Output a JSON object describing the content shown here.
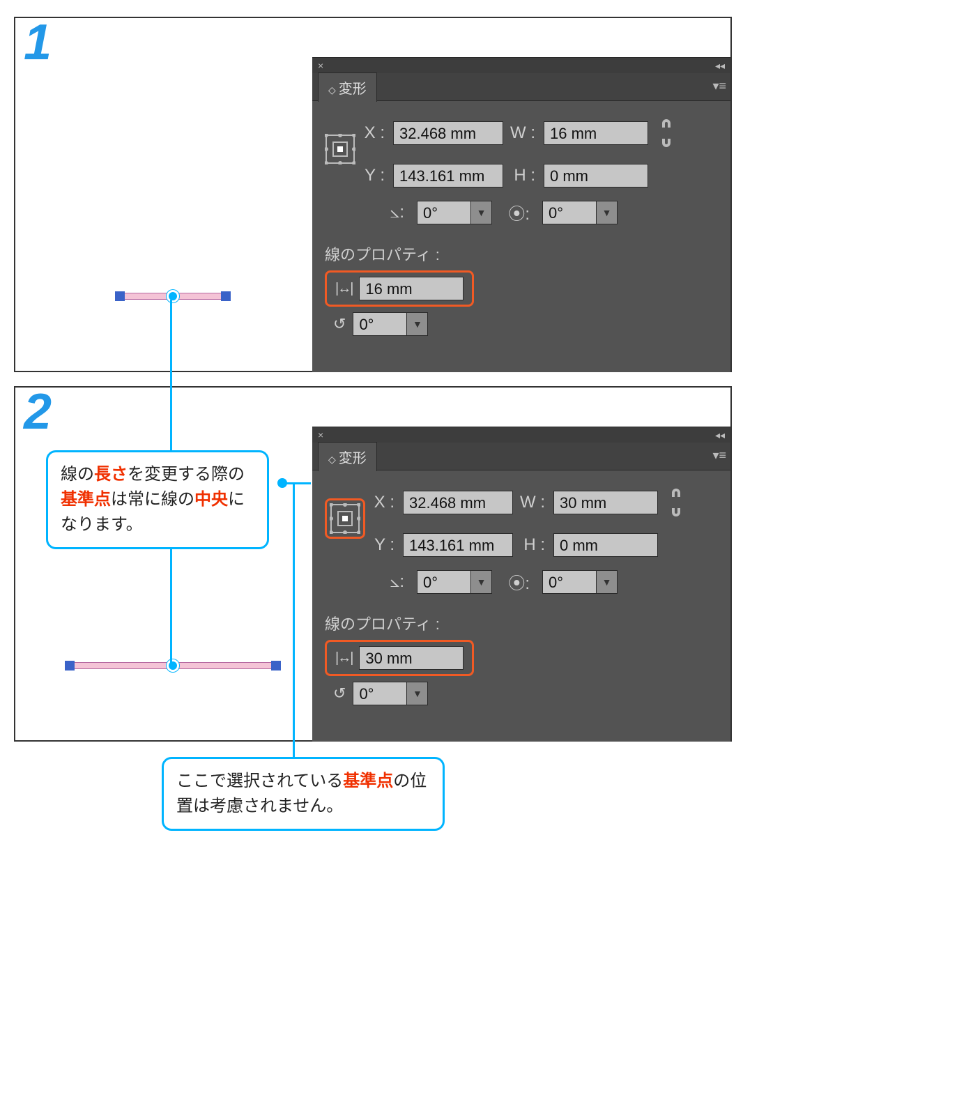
{
  "panel": {
    "title": "変形",
    "section_label": "線のプロパティ :",
    "labels": {
      "x": "X :",
      "y": "Y :",
      "w": "W :",
      "h": "H :"
    },
    "rotation": "0°",
    "shear": "0°"
  },
  "step1": {
    "num": "1",
    "x": "32.468 mm",
    "y": "143.161 mm",
    "w": "16 mm",
    "h": "0 mm",
    "length": "16 mm",
    "line_angle": "0°"
  },
  "step2": {
    "num": "2",
    "x": "32.468 mm",
    "y": "143.161 mm",
    "w": "30 mm",
    "h": "0 mm",
    "length": "30 mm",
    "line_angle": "0°"
  },
  "callouts": {
    "c1_a": "線の",
    "c1_b": "長さ",
    "c1_c": "を変更する際の",
    "c1_d": "基準点",
    "c1_e": "は常に線の",
    "c1_f": "中央",
    "c1_g": "になります。",
    "c2_a": "ここで選択されている",
    "c2_b": "基準点",
    "c2_c": "の位置は考慮されません。"
  }
}
